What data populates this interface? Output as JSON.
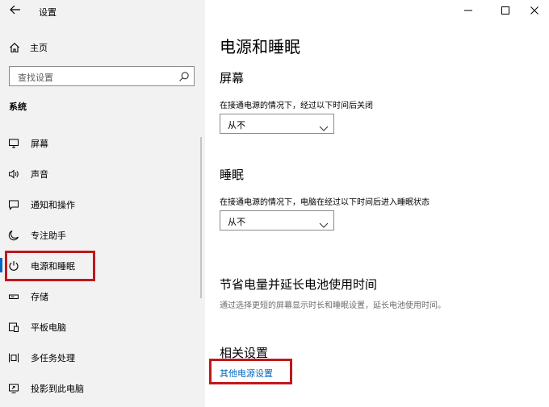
{
  "window": {
    "title": "设置",
    "controls": [
      "minimize",
      "maximize",
      "close"
    ]
  },
  "sidebar": {
    "home_label": "主页",
    "search_placeholder": "查找设置",
    "section_title": "系统",
    "items": [
      {
        "label": "屏幕",
        "icon": "monitor-icon",
        "selected": false
      },
      {
        "label": "声音",
        "icon": "speaker-icon",
        "selected": false
      },
      {
        "label": "通知和操作",
        "icon": "notification-icon",
        "selected": false
      },
      {
        "label": "专注助手",
        "icon": "moon-icon",
        "selected": false
      },
      {
        "label": "电源和睡眠",
        "icon": "power-icon",
        "selected": true
      },
      {
        "label": "存储",
        "icon": "storage-icon",
        "selected": false
      },
      {
        "label": "平板电脑",
        "icon": "tablet-icon",
        "selected": false
      },
      {
        "label": "多任务处理",
        "icon": "multitask-icon",
        "selected": false
      },
      {
        "label": "投影到此电脑",
        "icon": "project-icon",
        "selected": false
      }
    ]
  },
  "main": {
    "title": "电源和睡眠",
    "screen": {
      "heading": "屏幕",
      "description": "在接通电源的情况下，经过以下时间后关闭",
      "value": "从不"
    },
    "sleep": {
      "heading": "睡眠",
      "description": "在接通电源的情况下，电脑在经过以下时间后进入睡眠状态",
      "value": "从不"
    },
    "battery": {
      "heading": "节省电量并延长电池使用时间",
      "description": "通过选择更短的屏幕显示时长和睡眠设置，延长电池使用时间。"
    },
    "related": {
      "heading": "相关设置",
      "link": "其他电源设置"
    }
  },
  "colors": {
    "accent": "#0067c0",
    "highlight": "#c0181c",
    "sidebar_bg": "#f2f2f2"
  }
}
